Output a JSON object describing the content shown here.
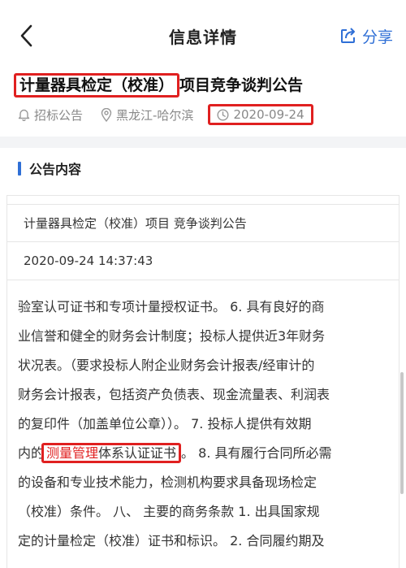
{
  "nav": {
    "title": "信息详情",
    "share_label": "分享",
    "back_icon": "chevron-left-icon",
    "share_icon": "share-icon",
    "accent_color": "#2f6fd6"
  },
  "headline": {
    "highlighted": "计量器具检定（校准）",
    "rest": "项目竞争谈判公告"
  },
  "meta": {
    "category": "招标公告",
    "location": "黑龙江-哈尔滨",
    "date": "2020-09-24"
  },
  "section": {
    "title": "公告内容"
  },
  "info_rows": {
    "project_title": "计量器具检定（校准）项目 竞争谈判公告",
    "timestamp": "2020-09-24 14:37:43"
  },
  "body": {
    "line1": "验室认可证书和专项计量授权证书。 6. 具有良好的商",
    "line2": "业信誉和健全的财务会计制度；投标人提供近3年财务",
    "line3": "状况表。（要求投标人附企业财务会计报表/经审计的",
    "line4": "财务会计报表，包括资产负债表、现金流量表、利润表",
    "line5": "的复印件（加盖单位公章））。 7. 投标人提供有效期",
    "line6_pre": "内的",
    "line6_red": "测量管理",
    "line6_boxed_rest": "体系认证证书",
    "line6_post": "。 8. 具有履行合同所必需",
    "line7": "的设备和专业技术能力，检测机构要求具备现场检定",
    "line8": "（校准）条件。 八、 主要的商务条款 1. 出具国家规",
    "line9": "定的计量检定（校准）证书和标识。 2. 合同履约期及"
  },
  "highlight_color": "#e02020"
}
